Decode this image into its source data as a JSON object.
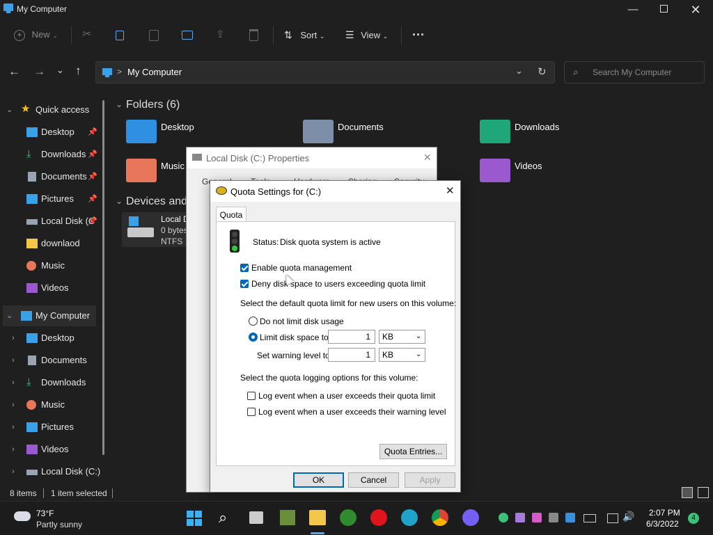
{
  "window": {
    "title": "My Computer"
  },
  "toolbar": {
    "new_label": "New",
    "sort_label": "Sort",
    "view_label": "View",
    "more_label": "···"
  },
  "address": {
    "location": "My Computer",
    "separator": ">"
  },
  "search": {
    "placeholder": "Search My Computer"
  },
  "sidebar": {
    "quick_access": {
      "label": "Quick access",
      "items": [
        {
          "label": "Desktop"
        },
        {
          "label": "Downloads"
        },
        {
          "label": "Documents"
        },
        {
          "label": "Pictures"
        },
        {
          "label": "Local Disk (C"
        },
        {
          "label": "downlaod"
        },
        {
          "label": "Music"
        },
        {
          "label": "Videos"
        }
      ]
    },
    "my_computer": {
      "label": "My Computer",
      "items": [
        {
          "label": "Desktop"
        },
        {
          "label": "Documents"
        },
        {
          "label": "Downloads"
        },
        {
          "label": "Music"
        },
        {
          "label": "Pictures"
        },
        {
          "label": "Videos"
        },
        {
          "label": "Local Disk (C:)"
        }
      ]
    }
  },
  "content": {
    "folders_header": "Folders (6)",
    "folders": [
      {
        "label": "Desktop"
      },
      {
        "label": "Documents"
      },
      {
        "label": "Downloads"
      },
      {
        "label": "Music"
      },
      {
        "label": "Videos"
      }
    ],
    "devices_header": "Devices and",
    "disk": {
      "name": "Local D",
      "size": "0 bytes",
      "fs": "NTFS"
    }
  },
  "status": {
    "items": "8 items",
    "selected": "1 item selected"
  },
  "props_dialog": {
    "title": "Local Disk (C:) Properties",
    "tabs": [
      "General",
      "Tools",
      "Hardware",
      "Sharing",
      "Security"
    ]
  },
  "quota_dialog": {
    "title": "Quota Settings for  (C:)",
    "tab": "Quota",
    "status_label": "Status:",
    "status_value": "Disk quota system is active",
    "enable_label": "Enable quota management",
    "deny_label": "Deny disk space to users exceeding quota limit",
    "default_limit_heading": "Select the default quota limit for new users on this volume:",
    "no_limit_label": "Do not limit disk usage",
    "limit_label": "Limit disk space to",
    "limit_value": "1",
    "limit_unit": "KB",
    "warn_label": "Set warning level to",
    "warn_value": "1",
    "warn_unit": "KB",
    "logging_heading": "Select the quota logging options for this volume:",
    "log_limit_label": "Log event when a user exceeds their quota limit",
    "log_warn_label": "Log event when a user exceeds their warning level",
    "entries_button": "Quota Entries...",
    "ok": "OK",
    "cancel": "Cancel",
    "apply": "Apply"
  },
  "taskbar": {
    "weather_temp": "73°F",
    "weather_desc": "Partly sunny",
    "time": "2:07 PM",
    "date": "6/3/2022",
    "badge": "4"
  }
}
